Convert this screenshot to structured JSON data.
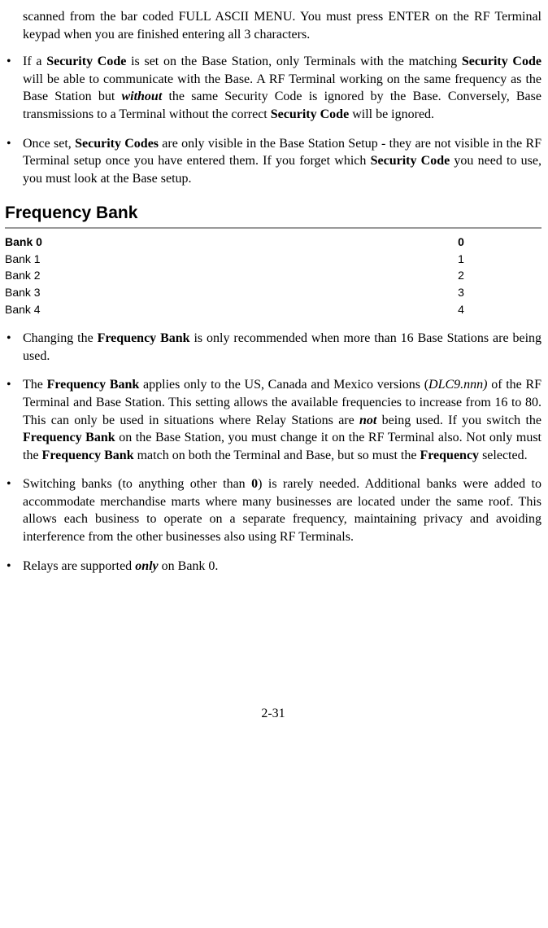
{
  "intro": {
    "partA": "scanned from the bar coded FULL ASCII MENU. You must press ENTER on the RF Terminal keypad when you are finished entering all 3 characters."
  },
  "bullets_top": [
    {
      "t1": "If a ",
      "b1": "Security Code",
      "t2": " is set on the Base Station, only Terminals with the matching ",
      "b2": "Security Code",
      "t3": " will be able to communicate with the Base. A RF Terminal working on the same frequency as the Base Station but ",
      "bi1": "without",
      "t4": " the same Security Code is ignored by the Base. Conversely, Base transmissions to a Terminal without the correct ",
      "b3": "Security Code",
      "t5": " will be ignored."
    },
    {
      "t1": "Once set, ",
      "b1": "Security Codes",
      "t2": " are only visible in the Base Station Setup - they are not visible in the RF Terminal setup once you have entered them.  If you forget which ",
      "b2": "Security Code",
      "t3": " you need to use, you must look at the Base setup."
    }
  ],
  "section_heading": "Frequency Bank",
  "bank_rows": [
    {
      "label": "Bank 0",
      "value": "0"
    },
    {
      "label": "Bank 1",
      "value": "1"
    },
    {
      "label": "Bank 2",
      "value": "2"
    },
    {
      "label": "Bank 3",
      "value": "3"
    },
    {
      "label": "Bank 4",
      "value": "4"
    }
  ],
  "bullets_bottom": {
    "b1": {
      "t1": "Changing the ",
      "b1": "Frequency Bank",
      "t2": " is only recommended when more than 16 Base Stations are being used."
    },
    "b2": {
      "t1": "The ",
      "b1": "Frequency Bank",
      "t2": " applies only to the US, Canada and Mexico versions (",
      "i1": "DLC9.nnn)",
      "t3": " of the RF Terminal and Base Station.  This setting allows the available frequencies to increase from 16 to 80.  This can only be used in situations where Relay Stations are ",
      "bi1": "not",
      "t4": " being used. If you switch the ",
      "b2": "Frequency Bank",
      "t5": " on the Base Station, you must change it on the RF Terminal also.  Not only must the ",
      "b3": "Frequency Bank",
      "t6": " match on both the Terminal and Base, but so must the ",
      "b4": "Frequency",
      "t7": " selected."
    },
    "b3": {
      "t1": "Switching banks (to anything other than ",
      "b1": "0",
      "t2": ") is rarely needed.  Additional banks were added to accommodate merchandise marts where many businesses are located under the same roof.  This allows each business to operate on a separate frequency, maintaining privacy and avoiding interference from the other businesses also using RF Terminals."
    },
    "b4": {
      "t1": "Relays are supported ",
      "bi1": "only",
      "t2": " on Bank 0."
    }
  },
  "page_number": "2-31"
}
